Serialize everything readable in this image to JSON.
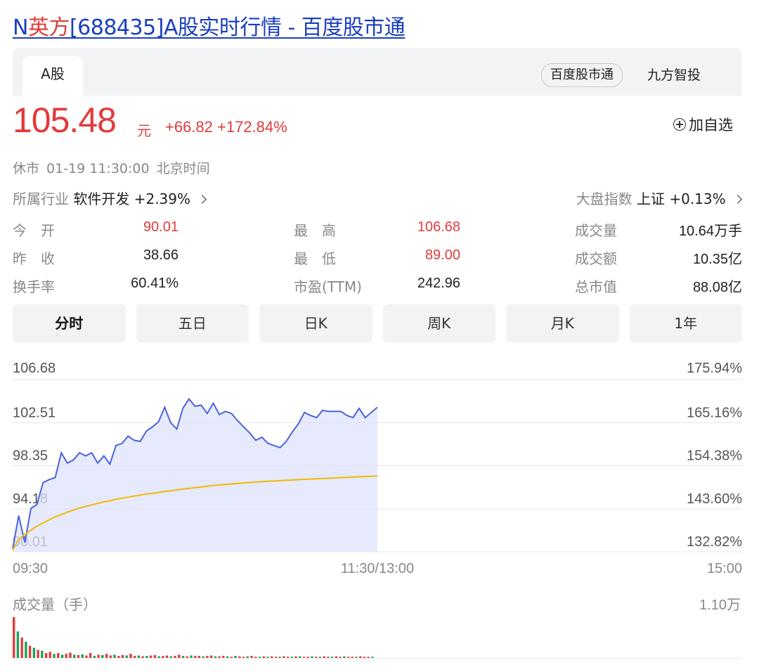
{
  "page": {
    "title_prefix": "N",
    "title_name": "英方",
    "title_rest": "[688435]A股实时行情 - 百度股市通"
  },
  "tabs": {
    "active": "A股",
    "pill": "百度股市通",
    "link": "九方智投"
  },
  "quote": {
    "price": "105.48",
    "unit": "元",
    "change": "+66.82 +172.84%",
    "add_label": "加自选",
    "status": "休市",
    "datetime": "01-19 11:30:00",
    "timezone": "北京时间"
  },
  "industry": {
    "label": "所属行业",
    "name": "软件开发",
    "change": "+2.39%"
  },
  "market": {
    "label": "大盘指数",
    "name": "上证",
    "change": "+0.13%"
  },
  "stats": {
    "open_label": "今　开",
    "open_value": "90.01",
    "prev_close_label": "昨　收",
    "prev_close_value": "38.66",
    "turnover_label": "换手率",
    "turnover_value": "60.41%",
    "high_label": "最　高",
    "high_value": "106.68",
    "low_label": "最　低",
    "low_value": "89.00",
    "pe_label": "市盈(TTM)",
    "pe_value": "242.96",
    "volume_label": "成交量",
    "volume_value": "10.64万手",
    "amount_label": "成交额",
    "amount_value": "10.35亿",
    "mktcap_label": "总市值",
    "mktcap_value": "88.08亿"
  },
  "periods": [
    "分时",
    "五日",
    "日K",
    "周K",
    "月K",
    "1年"
  ],
  "colors": {
    "up": "#e23b3b",
    "price_line": "#4a63e0",
    "avg_line": "#f5b800",
    "area_fill": "#dde3fb",
    "down": "#19a15f"
  },
  "chart_data": {
    "type": "line",
    "y_labels_left": [
      "106.68",
      "102.51",
      "98.35",
      "94.18",
      "90.01"
    ],
    "y_labels_right": [
      "175.94%",
      "165.16%",
      "154.38%",
      "143.60%",
      "132.82%"
    ],
    "x_labels": [
      "09:30",
      "11:30/13:00",
      "15:00"
    ],
    "ylim": [
      90.01,
      106.68
    ],
    "minutes_total": 240,
    "series": [
      {
        "x": [
          0,
          2,
          4,
          6,
          8,
          10,
          12,
          14,
          16,
          18,
          20,
          22,
          24,
          26,
          28,
          30,
          32,
          34,
          36,
          38,
          40,
          42,
          44,
          46,
          48,
          50,
          52,
          54,
          56,
          58,
          60,
          62,
          64,
          66,
          68,
          70,
          72,
          74,
          76,
          78,
          80,
          82,
          84,
          86,
          88,
          90,
          92,
          94,
          96,
          98,
          100,
          102,
          104,
          106,
          108,
          110,
          112,
          114,
          116,
          118,
          120
        ],
        "values": [
          90.3,
          93.5,
          90.9,
          94.2,
          94.6,
          96.7,
          97.0,
          97.2,
          99.6,
          98.6,
          98.9,
          99.6,
          99.3,
          99.6,
          98.6,
          99.3,
          98.5,
          100.3,
          100.5,
          101.2,
          100.8,
          100.7,
          101.7,
          102.1,
          102.6,
          104.0,
          102.5,
          101.9,
          103.9,
          104.8,
          104.1,
          104.2,
          103.4,
          104.4,
          103.3,
          103.6,
          103.4,
          102.7,
          102.1,
          101.5,
          100.8,
          101.1,
          100.5,
          100.3,
          100.1,
          100.7,
          101.6,
          102.4,
          103.5,
          103.2,
          103.0,
          103.7,
          103.6,
          103.6,
          103.6,
          103.2,
          103.0,
          103.9,
          103.0,
          103.5,
          104.0
        ]
      },
      {
        "x": [
          0,
          2,
          4,
          6,
          8,
          10,
          12,
          14,
          16,
          18,
          20,
          22,
          24,
          26,
          28,
          30,
          32,
          34,
          36,
          38,
          40,
          42,
          44,
          46,
          48,
          50,
          52,
          54,
          56,
          58,
          60,
          62,
          64,
          66,
          68,
          70,
          72,
          74,
          76,
          78,
          80,
          82,
          84,
          86,
          88,
          90,
          92,
          94,
          96,
          98,
          100,
          102,
          104,
          106,
          108,
          110,
          112,
          114,
          116,
          118,
          120
        ],
        "values": [
          90.2,
          91.2,
          91.7,
          92.1,
          92.5,
          92.8,
          93.1,
          93.4,
          93.6,
          93.85,
          94.05,
          94.25,
          94.4,
          94.55,
          94.7,
          94.85,
          94.95,
          95.1,
          95.2,
          95.3,
          95.4,
          95.5,
          95.6,
          95.68,
          95.75,
          95.85,
          95.92,
          96.0,
          96.08,
          96.15,
          96.22,
          96.28,
          96.35,
          96.42,
          96.48,
          96.53,
          96.58,
          96.62,
          96.68,
          96.72,
          96.76,
          96.8,
          96.84,
          96.87,
          96.9,
          96.93,
          96.96,
          96.99,
          97.02,
          97.05,
          97.08,
          97.1,
          97.13,
          97.16,
          97.19,
          97.22,
          97.24,
          97.27,
          97.3,
          97.32,
          97.35
        ]
      }
    ]
  },
  "volume": {
    "label": "成交量（手）",
    "max_label": "1.10万",
    "bars": [
      1.0,
      0.65,
      0.5,
      0.4,
      0.3,
      0.25,
      0.2,
      0.18,
      0.12,
      0.15,
      0.1,
      0.12,
      0.08,
      0.1,
      0.13,
      0.08,
      0.07,
      0.09,
      0.06,
      0.12,
      0.05,
      0.08,
      0.07,
      0.1,
      0.06,
      0.08,
      0.05,
      0.07,
      0.06,
      0.1,
      0.05,
      0.06,
      0.04,
      0.05,
      0.06,
      0.07,
      0.04,
      0.05,
      0.06,
      0.04,
      0.05,
      0.08,
      0.05,
      0.04,
      0.06,
      0.05,
      0.05,
      0.04,
      0.05,
      0.06,
      0.04,
      0.04,
      0.05,
      0.04,
      0.03,
      0.05,
      0.04,
      0.03,
      0.04,
      0.05,
      0.03,
      0.03,
      0.04,
      0.03,
      0.04,
      0.03,
      0.03,
      0.04,
      0.03,
      0.03,
      0.04,
      0.04,
      0.03,
      0.03,
      0.04,
      0.03,
      0.03,
      0.04,
      0.03,
      0.03,
      0.04,
      0.03,
      0.04,
      0.03,
      0.03,
      0.03,
      0.04,
      0.03,
      0.03,
      0.03
    ],
    "bar_colors": [
      "up",
      "down",
      "up",
      "down",
      "up",
      "down",
      "up",
      "down",
      "up",
      "up",
      "down",
      "up",
      "down",
      "up",
      "up",
      "down",
      "up",
      "down",
      "up",
      "up",
      "down",
      "up",
      "down",
      "up",
      "up",
      "down",
      "up",
      "up",
      "down",
      "up",
      "up",
      "down",
      "up",
      "down",
      "up",
      "up",
      "down",
      "up",
      "up",
      "down",
      "up",
      "up",
      "down",
      "up",
      "down",
      "up",
      "up",
      "down",
      "up",
      "up",
      "down",
      "up",
      "up",
      "down",
      "up",
      "down",
      "up",
      "up",
      "down",
      "up",
      "up",
      "down",
      "up",
      "down",
      "up",
      "up",
      "down",
      "up",
      "up",
      "down",
      "up",
      "down",
      "up",
      "up",
      "down",
      "up",
      "down",
      "up",
      "up",
      "down",
      "up",
      "up",
      "down",
      "up",
      "up",
      "down",
      "up",
      "up",
      "up",
      "down"
    ]
  }
}
